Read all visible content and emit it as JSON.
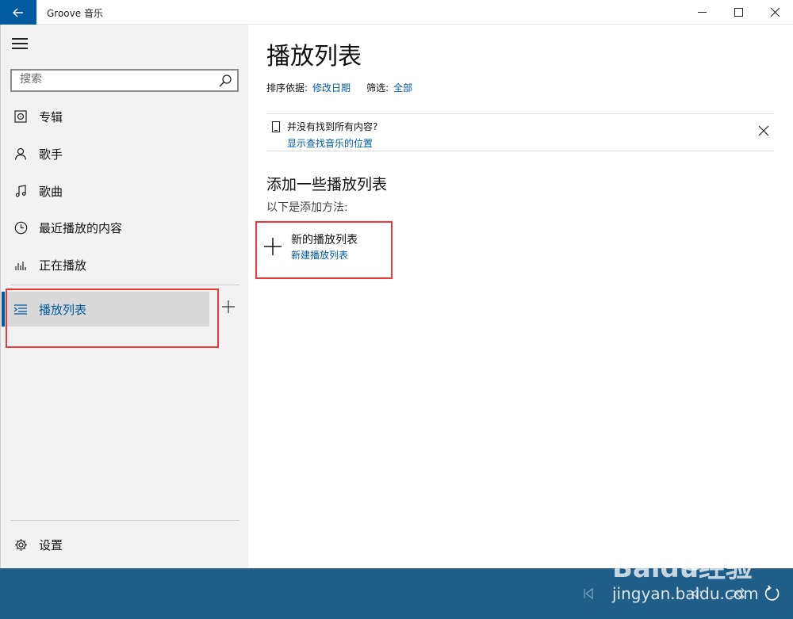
{
  "window": {
    "title": "Groove 音乐"
  },
  "sidebar": {
    "search": {
      "placeholder": "搜索",
      "value": ""
    },
    "items": [
      {
        "label": "专辑",
        "icon": "album-icon"
      },
      {
        "label": "歌手",
        "icon": "artist-icon"
      },
      {
        "label": "歌曲",
        "icon": "music-note-icon"
      },
      {
        "label": "最近播放的内容",
        "icon": "clock-icon"
      },
      {
        "label": "正在播放",
        "icon": "equalizer-icon"
      }
    ],
    "playlist_item": {
      "label": "播放列表",
      "icon": "playlist-icon",
      "active": true
    },
    "settings": {
      "label": "设置",
      "icon": "gear-icon"
    }
  },
  "main": {
    "title": "播放列表",
    "sort_label": "排序依据:",
    "sort_value": "修改日期",
    "filter_label": "筛选:",
    "filter_value": "全部",
    "notice": {
      "text": "并没有找到所有内容?",
      "link": "显示查找音乐的位置"
    },
    "section_title": "添加一些播放列表",
    "section_sub": "以下是添加方法:",
    "new_playlist": {
      "title": "新的播放列表",
      "link": "新建播放列表"
    }
  },
  "watermark": {
    "brand": "Baidu经验",
    "url": "jingyan.baidu.com"
  },
  "colors": {
    "accent": "#005a9e",
    "player_bar": "#1f5e89",
    "highlight_box": "#e83a3a"
  }
}
